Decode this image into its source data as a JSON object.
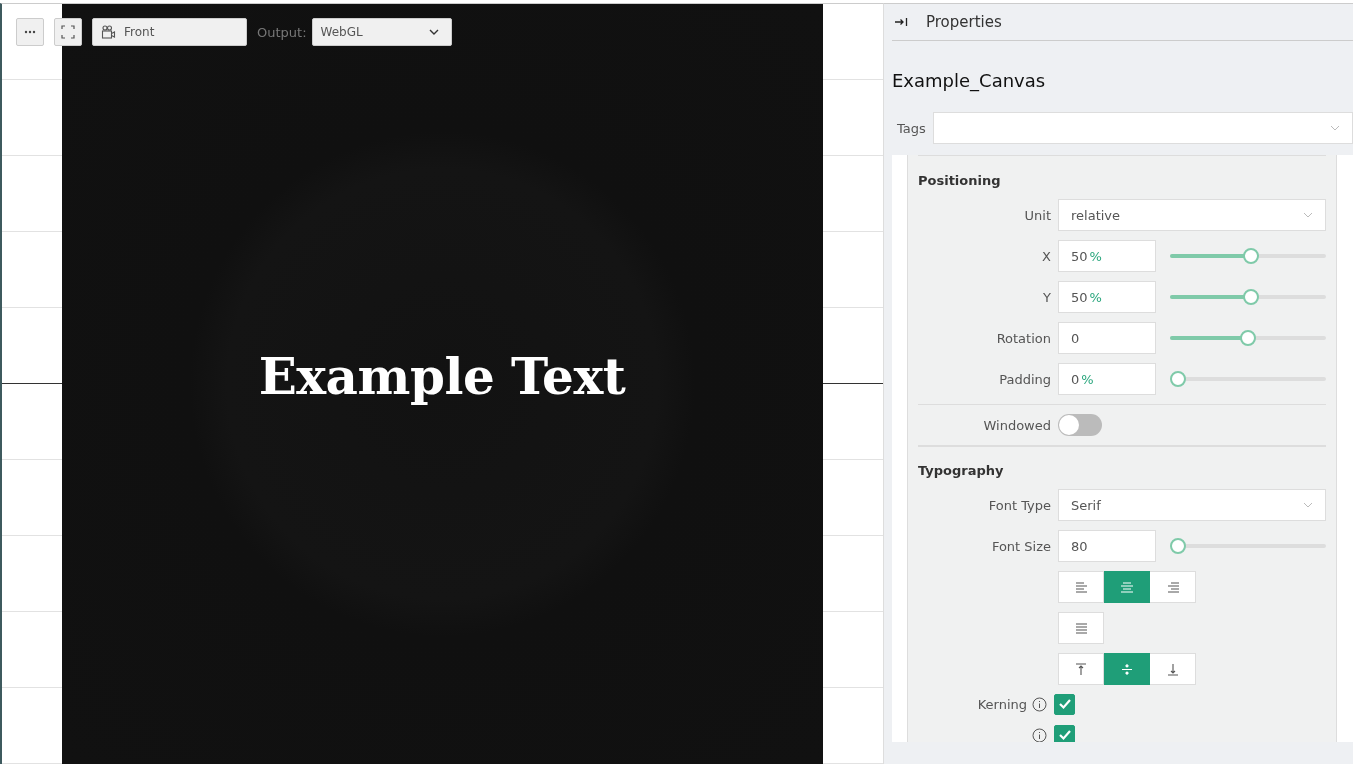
{
  "toolbar": {
    "camera": "Front",
    "output_label": "Output:",
    "output": "WebGL"
  },
  "canvas": {
    "text": "Example Text"
  },
  "panel": {
    "title": "Properties",
    "object_name": "Example_Canvas",
    "tags_label": "Tags"
  },
  "sections": [
    {
      "heading": "Positioning",
      "rows": [
        {
          "kind": "select",
          "label": "Unit",
          "value": "relative"
        },
        {
          "kind": "slider",
          "label": "X",
          "value": "50",
          "unit": "%",
          "level": 0.52
        },
        {
          "kind": "slider",
          "label": "Y",
          "value": "50",
          "unit": "%",
          "level": 0.52
        },
        {
          "kind": "slider",
          "label": "Rotation",
          "value": "0",
          "level": 0.5
        },
        {
          "kind": "slider",
          "label": "Padding",
          "value": "0",
          "unit": "%",
          "level": 0
        },
        {
          "kind": "toggle",
          "label": "Windowed",
          "on": false
        }
      ]
    },
    {
      "heading": "Typography",
      "rows": [
        {
          "kind": "select",
          "label": "Font Type",
          "value": "Serif"
        },
        {
          "kind": "slider",
          "label": "Font Size",
          "value": "80",
          "level": 0
        },
        {
          "kind": "buttons",
          "buttons": [
            {
              "kind": "left",
              "selected": false
            },
            {
              "kind": "center",
              "selected": true
            },
            {
              "kind": "right",
              "selected": false
            }
          ]
        },
        {
          "kind": "buttons",
          "buttons": [
            {
              "kind": "justify",
              "selected": false
            }
          ]
        },
        {
          "kind": "buttons",
          "buttons": [
            {
              "kind": "top",
              "selected": false
            },
            {
              "kind": "middle",
              "selected": true
            },
            {
              "kind": "bottom",
              "selected": false
            }
          ]
        },
        {
          "kind": "checkbox",
          "label": "Kerning",
          "checked": true
        },
        {
          "kind": "checkbox",
          "checked": true
        }
      ]
    }
  ]
}
